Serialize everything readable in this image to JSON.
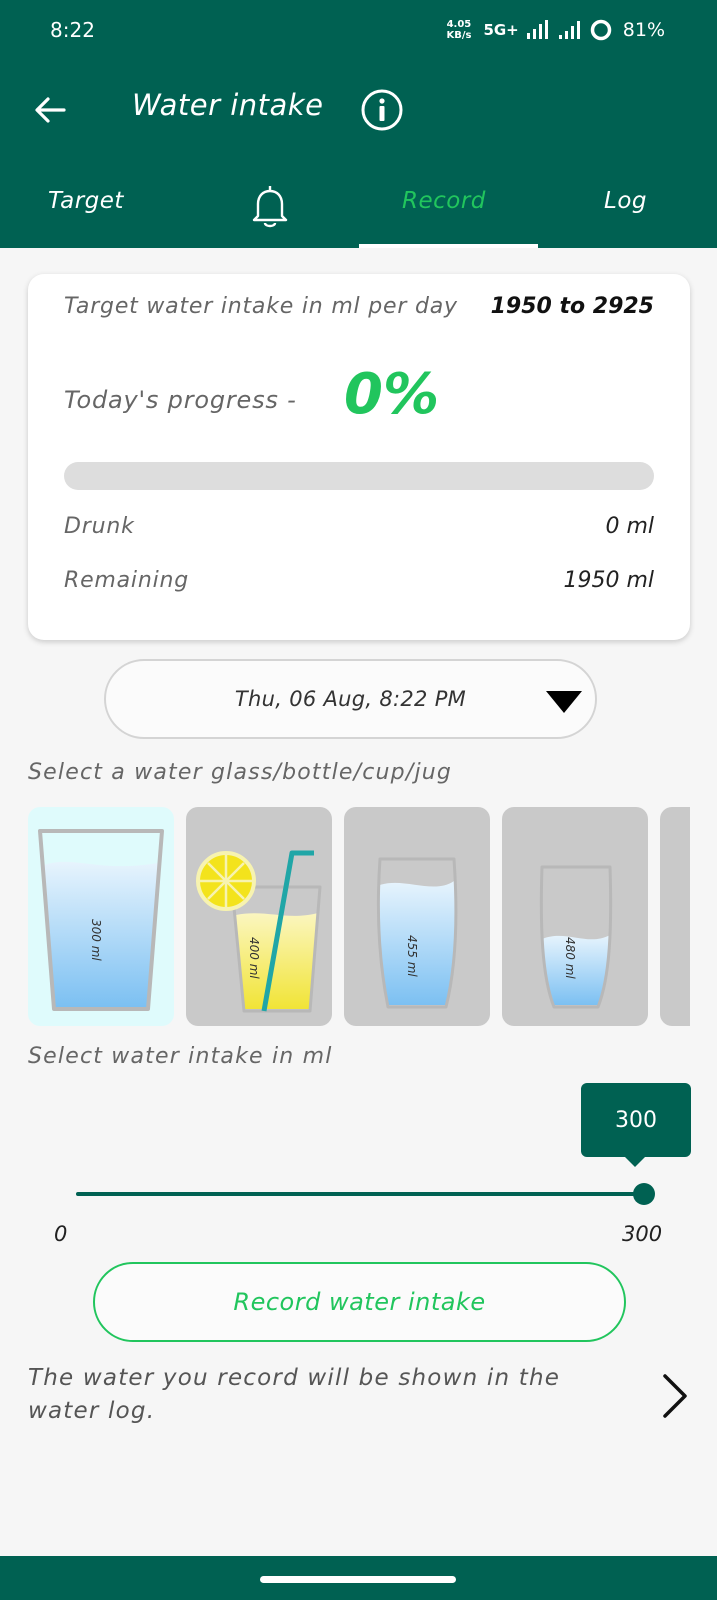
{
  "status_bar": {
    "time": "8:22",
    "net_speed_value": "4.05",
    "net_speed_unit": "KB/s",
    "network_type": "5G+",
    "battery": "81%"
  },
  "header": {
    "title": "Water intake"
  },
  "tabs": [
    {
      "label": "Target"
    },
    {
      "label": ""
    },
    {
      "label": "Record",
      "active": true
    },
    {
      "label": "Log"
    }
  ],
  "summary": {
    "target_label": "Target water intake in ml per day",
    "target_value": "1950 to 2925",
    "progress_label": "Today's progress -",
    "progress_value": "0%",
    "progress_fraction": 0,
    "drunk_label": "Drunk",
    "drunk_value": "0 ml",
    "remaining_label": "Remaining",
    "remaining_value": "1950 ml"
  },
  "date_picker": {
    "value": "Thu, 06 Aug, 8:22 PM"
  },
  "glass_section_label": "Select a water glass/bottle/cup/jug",
  "glasses": [
    {
      "label": "300 ml",
      "selected": true
    },
    {
      "label": "400 ml"
    },
    {
      "label": "455 ml"
    },
    {
      "label": "480 ml"
    }
  ],
  "intake_section_label": "Select water intake in ml",
  "slider": {
    "value_label": "300",
    "min_label": "0",
    "max_label": "300",
    "value": 300,
    "min": 0,
    "max": 300
  },
  "record_button": "Record water intake",
  "hint": "The water you record will be shown in the water log.",
  "colors": {
    "primary": "#006152",
    "accent": "#21c55d",
    "water": "#8fcaf3"
  }
}
